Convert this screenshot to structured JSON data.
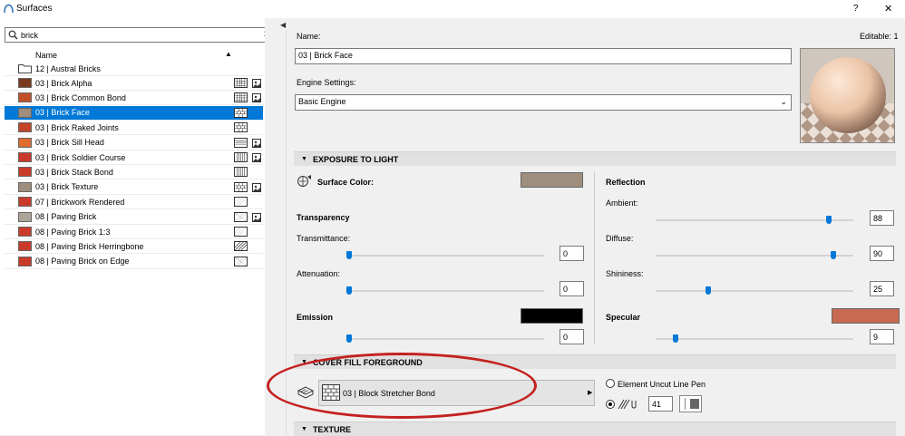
{
  "window": {
    "title": "Surfaces",
    "help": "?",
    "close": "✕"
  },
  "search": {
    "value": "brick",
    "clear": "✕"
  },
  "list": {
    "header": "Name",
    "folder": "12 | Austral Bricks",
    "items": [
      {
        "label": "03 | Brick Alpha",
        "color": "#7b3a20",
        "tex": true
      },
      {
        "label": "03 | Brick Common Bond",
        "color": "#c2502a",
        "tex": true
      },
      {
        "label": "03 | Brick Face",
        "color": "#9f8e7d",
        "tex": false,
        "selected": true
      },
      {
        "label": "03 | Brick Raked Joints",
        "color": "#c2452a",
        "tex": false
      },
      {
        "label": "03 | Brick Sill Head",
        "color": "#dd6c2d",
        "tex": true
      },
      {
        "label": "03 | Brick Soldier Course",
        "color": "#c93a2a",
        "tex": true
      },
      {
        "label": "03 | Brick Stack Bond",
        "color": "#c93a2a",
        "tex": false
      },
      {
        "label": "03 | Brick Texture",
        "color": "#9f8e7d",
        "tex": true
      },
      {
        "label": "07 | Brickwork Rendered",
        "color": "#c93a2a",
        "tex": false
      },
      {
        "label": "08 | Paving Brick",
        "color": "#aaa596",
        "tex": true
      },
      {
        "label": "08 | Paving Brick 1:3",
        "color": "#c93a2a",
        "tex": false
      },
      {
        "label": "08 | Paving Brick Herringbone",
        "color": "#c93a2a",
        "tex": false
      },
      {
        "label": "08 | Paving Brick on Edge",
        "color": "#c93a2a",
        "tex": false
      }
    ]
  },
  "panel": {
    "name_label": "Name:",
    "editable": "Editable: 1",
    "name_value": "03 | Brick Face",
    "engine_label": "Engine Settings:",
    "engine_value": "Basic Engine"
  },
  "exposure": {
    "header": "EXPOSURE TO LIGHT",
    "surface_color_label": "Surface Color:",
    "surface_color": "#9f8e7d",
    "transparency_label": "Transparency",
    "transmittance_label": "Transmittance:",
    "transmittance": "0",
    "attenuation_label": "Attenuation:",
    "attenuation": "0",
    "emission_label": "Emission",
    "emission": "0",
    "emission_color": "#000000",
    "reflection_label": "Reflection",
    "ambient_label": "Ambient:",
    "ambient": "88",
    "diffuse_label": "Diffuse:",
    "diffuse": "90",
    "shininess_label": "Shininess:",
    "shininess": "25",
    "specular_label": "Specular",
    "specular": "9",
    "specular_color": "#c86a52"
  },
  "cover_fill": {
    "header": "COVER FILL FOREGROUND",
    "fill_value": "03 | Block Stretcher Bond",
    "uncut_pen_label": "Element Uncut Line Pen",
    "pen_value": "41"
  },
  "texture": {
    "header": "TEXTURE"
  }
}
